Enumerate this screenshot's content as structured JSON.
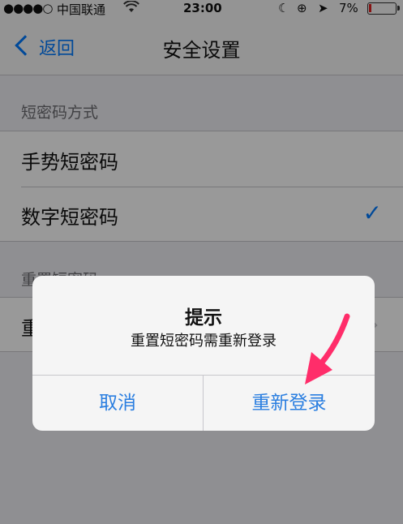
{
  "status_bar": {
    "signal": "●●●●○",
    "carrier": "中国联通",
    "wifi": "wifi-icon",
    "time": "23:00",
    "battery_percent": "7%"
  },
  "nav": {
    "back_label": "返回",
    "title": "安全设置"
  },
  "sections": {
    "passcode_method": {
      "header": "短密码方式",
      "items": [
        {
          "label": "手势短密码",
          "checked": false
        },
        {
          "label": "数字短密码",
          "checked": true
        }
      ],
      "check_glyph": "✓"
    },
    "reset": {
      "header": "重置短密码",
      "item_label": "重"
    }
  },
  "alert": {
    "title": "提示",
    "message": "重置短密码需重新登录",
    "cancel_label": "取消",
    "confirm_label": "重新登录"
  },
  "colors": {
    "accent": "#007aff",
    "arrow": "#ff2d6a"
  }
}
